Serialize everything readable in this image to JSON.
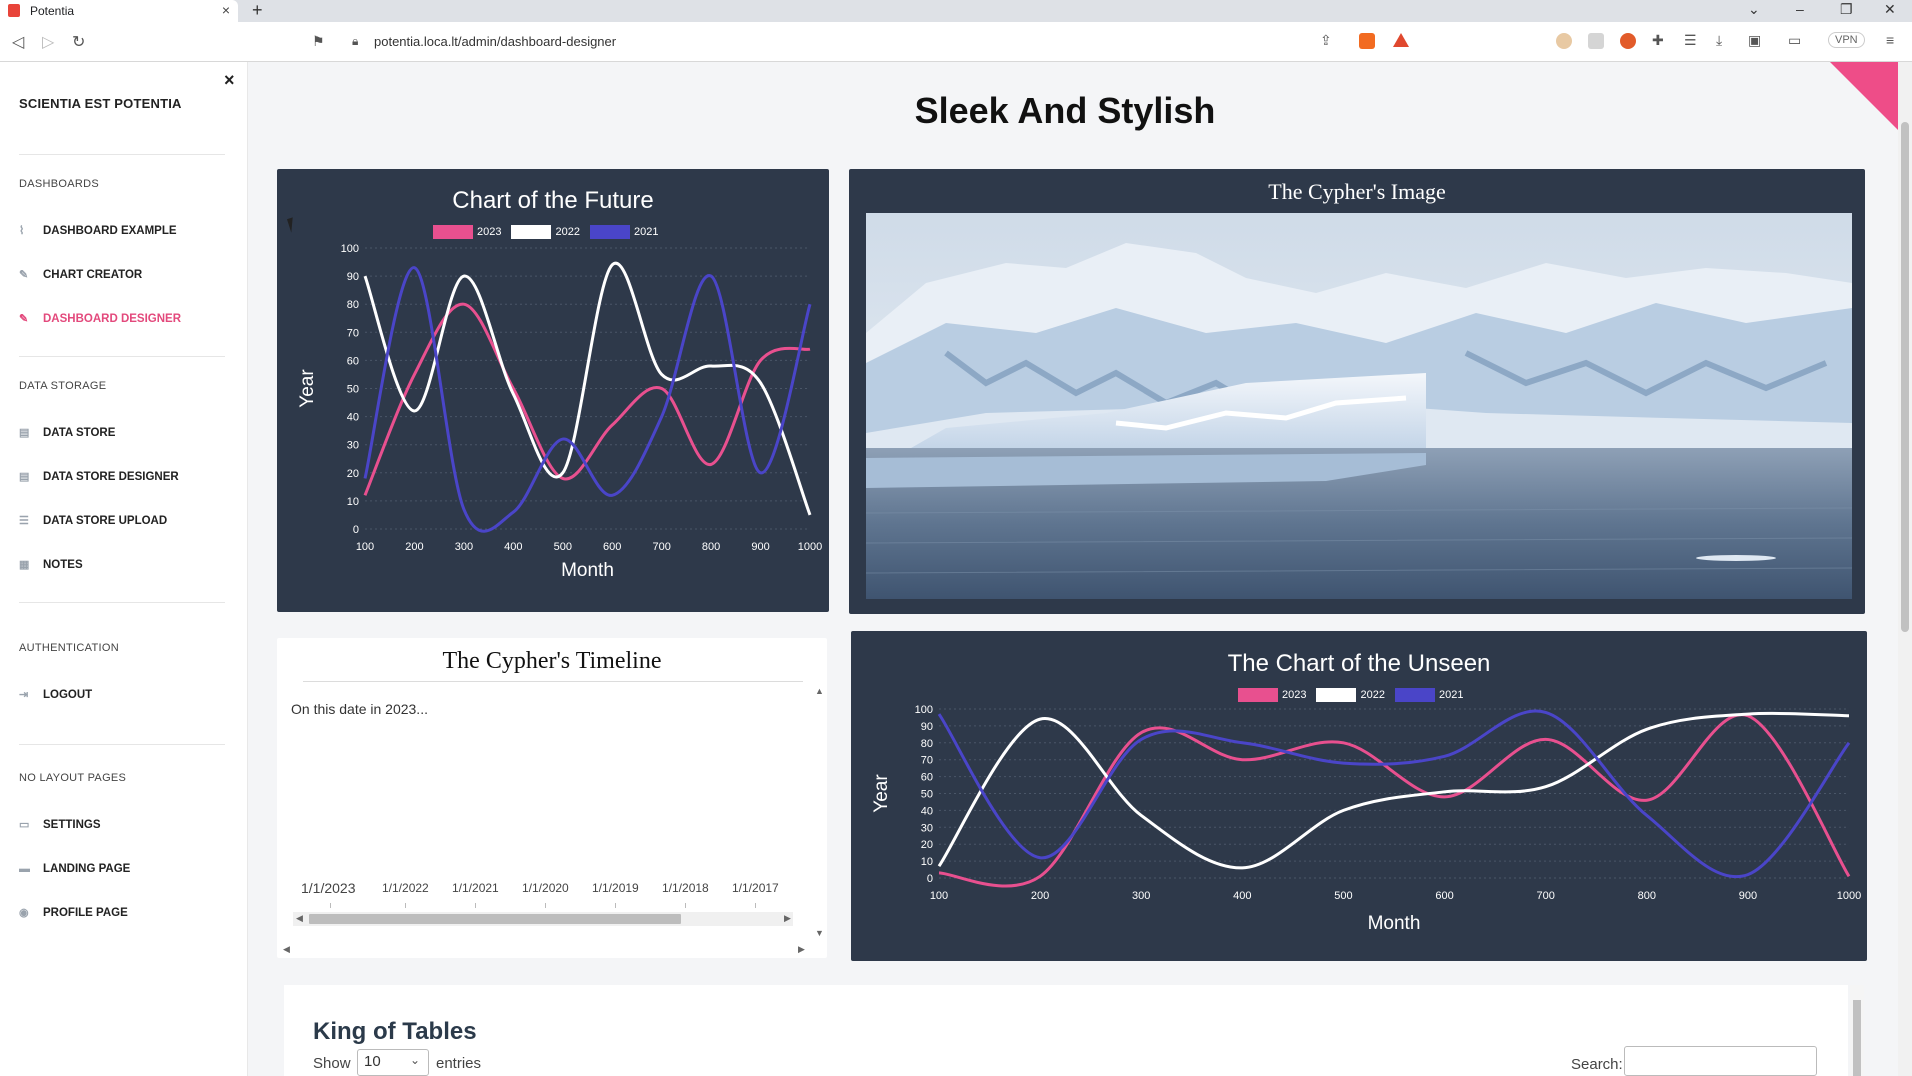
{
  "browser": {
    "tab_title": "Potentia",
    "tab_close": "×",
    "new_tab": "+",
    "url": "potentia.loca.lt/admin/dashboard-designer",
    "vpn_label": "VPN"
  },
  "sidebar": {
    "brand": "SCIENTIA EST POTENTIA",
    "close": "×",
    "sections": [
      {
        "title": "DASHBOARDS",
        "items": [
          {
            "label": "DASHBOARD EXAMPLE",
            "icon": "chart-icon"
          },
          {
            "label": "CHART CREATOR",
            "icon": "edit-icon"
          },
          {
            "label": "DASHBOARD DESIGNER",
            "icon": "edit-icon",
            "active": true
          }
        ]
      },
      {
        "title": "DATA STORAGE",
        "items": [
          {
            "label": "DATA STORE",
            "icon": "file-icon"
          },
          {
            "label": "DATA STORE DESIGNER",
            "icon": "file-icon"
          },
          {
            "label": "DATA STORE UPLOAD",
            "icon": "list-icon"
          },
          {
            "label": "NOTES",
            "icon": "note-icon"
          }
        ]
      },
      {
        "title": "AUTHENTICATION",
        "items": [
          {
            "label": "LOGOUT",
            "icon": "logout-icon"
          }
        ]
      },
      {
        "title": "NO LAYOUT PAGES",
        "items": [
          {
            "label": "SETTINGS",
            "icon": "monitor-icon"
          },
          {
            "label": "LANDING PAGE",
            "icon": "card-icon"
          },
          {
            "label": "PROFILE PAGE",
            "icon": "user-icon"
          }
        ]
      }
    ]
  },
  "page": {
    "title": "Sleek And Stylish",
    "accent_color": "#ee4d88"
  },
  "image_card": {
    "title": "The Cypher's Image"
  },
  "timeline": {
    "title": "The Cypher's Timeline",
    "text": "On this date in 2023...",
    "dates": [
      "1/1/2023",
      "1/1/2022",
      "1/1/2021",
      "1/1/2020",
      "1/1/2019",
      "1/1/2018",
      "1/1/2017"
    ]
  },
  "table": {
    "title": "King of Tables",
    "show_label": "Show",
    "show_value": "10",
    "entries_label": "entries",
    "search_label": "Search:"
  },
  "chart_data": [
    {
      "type": "line",
      "title": "Chart of the Future",
      "xlabel": "Month",
      "ylabel": "Year",
      "x": [
        100,
        200,
        300,
        400,
        500,
        600,
        700,
        800,
        900,
        1000
      ],
      "xticks": [
        "100",
        "200",
        "300",
        "400",
        "500",
        "600",
        "700",
        "800",
        "900",
        "1000"
      ],
      "yticks": [
        "0",
        "10",
        "20",
        "30",
        "40",
        "50",
        "60",
        "70",
        "80",
        "90",
        "100"
      ],
      "ylim": [
        0,
        100
      ],
      "series": [
        {
          "name": "2023",
          "color": "#e8508f",
          "values": [
            12,
            55,
            80,
            50,
            18,
            37,
            50,
            23,
            60,
            64
          ]
        },
        {
          "name": "2022",
          "color": "#ffffff",
          "values": [
            90,
            42,
            90,
            48,
            20,
            94,
            55,
            58,
            52,
            5
          ]
        },
        {
          "name": "2021",
          "color": "#4a45c8",
          "values": [
            18,
            93,
            7,
            6,
            32,
            12,
            40,
            90,
            20,
            80
          ]
        }
      ]
    },
    {
      "type": "line",
      "title": "The Chart of the Unseen",
      "xlabel": "Month",
      "ylabel": "Year",
      "x": [
        100,
        200,
        300,
        400,
        500,
        600,
        700,
        800,
        900,
        1000
      ],
      "xticks": [
        "100",
        "200",
        "300",
        "400",
        "500",
        "600",
        "700",
        "800",
        "900",
        "1000"
      ],
      "yticks": [
        "0",
        "10",
        "20",
        "30",
        "40",
        "50",
        "60",
        "70",
        "80",
        "90",
        "100"
      ],
      "ylim": [
        0,
        100
      ],
      "series": [
        {
          "name": "2023",
          "color": "#e8508f",
          "values": [
            3,
            1,
            86,
            70,
            80,
            48,
            82,
            46,
            96,
            1
          ]
        },
        {
          "name": "2022",
          "color": "#ffffff",
          "values": [
            7,
            94,
            37,
            6,
            40,
            51,
            54,
            88,
            97,
            96
          ]
        },
        {
          "name": "2021",
          "color": "#4a45c8",
          "values": [
            97,
            12,
            82,
            80,
            68,
            72,
            98,
            37,
            2,
            80
          ]
        }
      ]
    }
  ]
}
